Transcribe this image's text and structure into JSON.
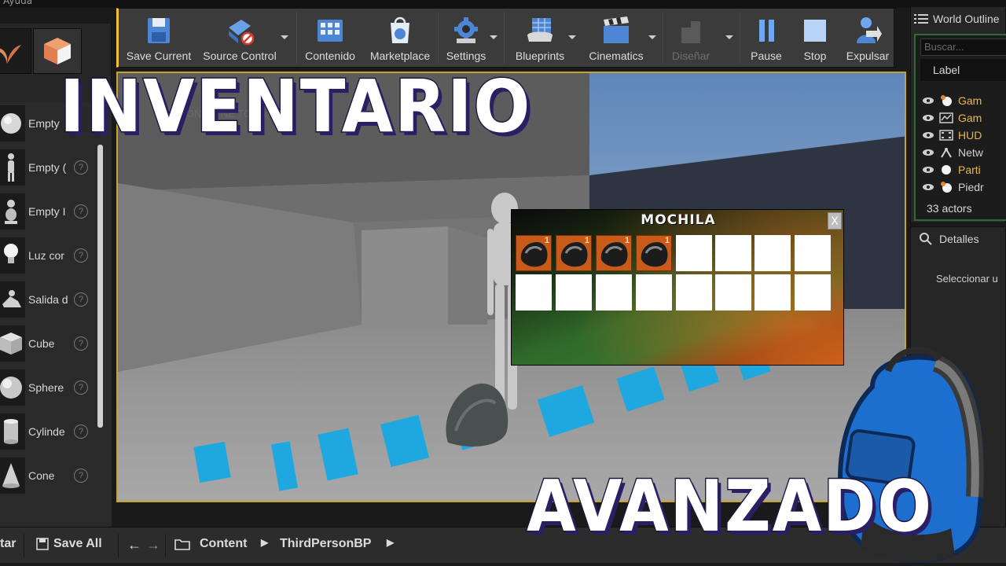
{
  "menu_fragment": "Ayuda",
  "toolbar": {
    "buttons": [
      {
        "label": "Save Current",
        "icon": "save-icon"
      },
      {
        "label": "Source Control",
        "icon": "source-control-icon"
      },
      {
        "label": "Contenido",
        "icon": "content-icon"
      },
      {
        "label": "Marketplace",
        "icon": "marketplace-icon"
      },
      {
        "label": "Settings",
        "icon": "settings-icon"
      },
      {
        "label": "Blueprints",
        "icon": "blueprints-icon"
      },
      {
        "label": "Cinematics",
        "icon": "cinematics-icon"
      },
      {
        "label": "Diseñar",
        "icon": "build-icon"
      },
      {
        "label": "Pause",
        "icon": "pause-icon"
      },
      {
        "label": "Stop",
        "icon": "stop-icon"
      },
      {
        "label": "Expulsar",
        "icon": "eject-icon"
      }
    ]
  },
  "place_panel": {
    "items": [
      {
        "label": "Empty",
        "icon": "sphere-icon"
      },
      {
        "label": "Empty (",
        "icon": "character-icon"
      },
      {
        "label": "Empty I",
        "icon": "pawn-icon"
      },
      {
        "label": "Luz cor",
        "icon": "light-bulb-icon"
      },
      {
        "label": "Salida d",
        "icon": "player-start-icon"
      },
      {
        "label": "Cube",
        "icon": "cube-icon"
      },
      {
        "label": "Sphere",
        "icon": "sphere-icon"
      },
      {
        "label": "Cylinde",
        "icon": "cylinder-icon"
      },
      {
        "label": "Cone",
        "icon": "cone-icon"
      }
    ],
    "help": "?"
  },
  "viewport": {
    "template_text": "ERSON CA  NE  TO    E    ou"
  },
  "inventory": {
    "title": "MOCHILA",
    "close": "X",
    "rows": 2,
    "cols": 8,
    "filled_slots": [
      {
        "qty": "1",
        "item_icon": "rock-icon"
      },
      {
        "qty": "1",
        "item_icon": "rock-icon"
      },
      {
        "qty": "1",
        "item_icon": "rock-icon"
      },
      {
        "qty": "1",
        "item_icon": "rock-icon"
      }
    ]
  },
  "outliner": {
    "tab": "World Outline",
    "search_placeholder": "Buscar...",
    "column": "Label",
    "rows": [
      {
        "label": "Gam",
        "color": "#e8b64c"
      },
      {
        "label": "Gam",
        "color": "#e8b64c"
      },
      {
        "label": "HUD",
        "color": "#e8b64c"
      },
      {
        "label": "Netw",
        "color": "#d0d0d0"
      },
      {
        "label": "Parti",
        "color": "#e8b64c"
      },
      {
        "label": "Piedr",
        "color": "#d0d0d0"
      }
    ],
    "actor_count": "33 actors"
  },
  "details": {
    "tab": "Detalles",
    "hint": "Seleccionar u"
  },
  "bottombar": {
    "fragment": "tar",
    "save_all": "Save All",
    "breadcrumb": [
      "Content",
      "ThirdPersonBP"
    ]
  },
  "overlay": {
    "title_top": "INVENTARIO",
    "title_bottom": "AVANZADO"
  },
  "colors": {
    "accent_outline": "#c8a22a",
    "overlay_stroke": "#1c1440",
    "floor_text": "#1fa8e0"
  }
}
